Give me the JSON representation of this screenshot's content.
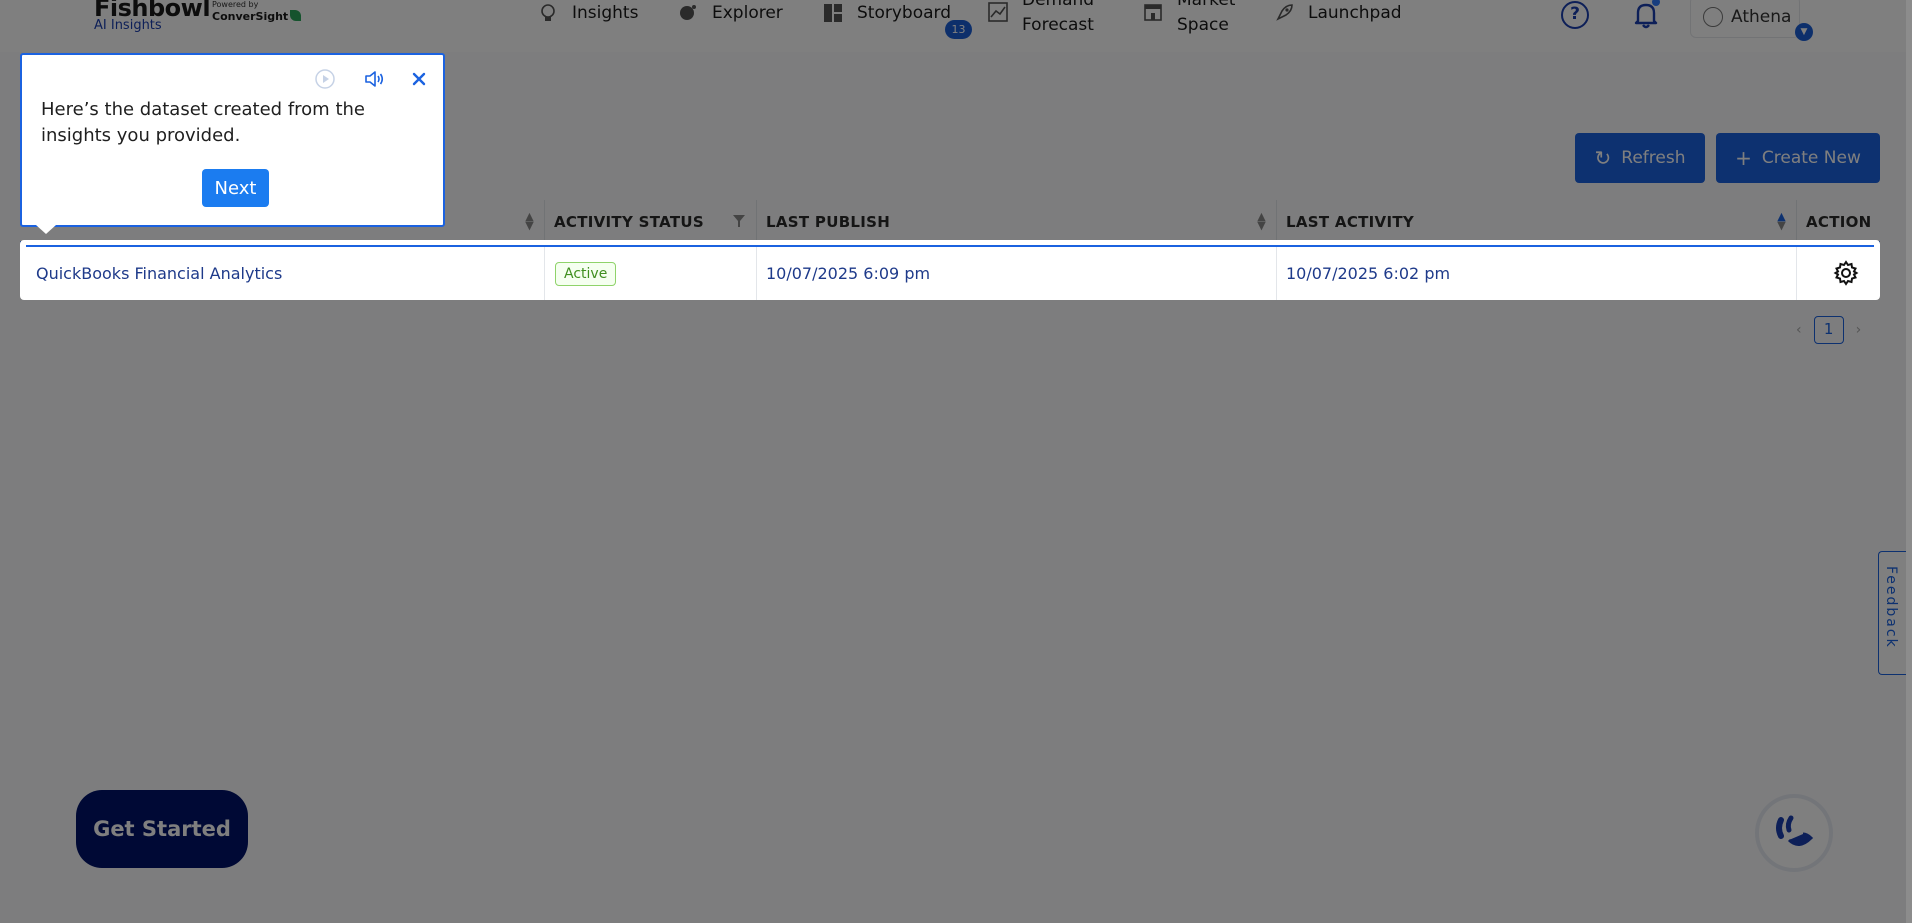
{
  "header": {
    "logo_main": "Fishbowl",
    "logo_sub": "AI Insights",
    "powered_by": "Powered by",
    "powered_brand": "ConverSight",
    "nav": [
      {
        "label": "Insights",
        "icon": "bulb-icon"
      },
      {
        "label": "Explorer",
        "icon": "explore-icon"
      },
      {
        "label": "Storyboard",
        "icon": "storyboard-icon",
        "badge": "13"
      },
      {
        "label_line1": "Demand",
        "label_line2": "Forecast",
        "icon": "chart-icon"
      },
      {
        "label_line1": "Market",
        "label_line2": "Space",
        "icon": "store-icon"
      },
      {
        "label": "Launchpad",
        "icon": "rocket-icon"
      }
    ],
    "help_glyph": "?",
    "user_name": "Athena"
  },
  "toolbar": {
    "refresh_label": "Refresh",
    "create_label": "Create New"
  },
  "table": {
    "columns": [
      "",
      "ACTIVITY STATUS",
      "LAST PUBLISH",
      "LAST ACTIVITY",
      "ACTION"
    ],
    "rows": [
      {
        "name": "QuickBooks Financial Analytics",
        "status": "Active",
        "last_publish": "10/07/2025 6:09 pm",
        "last_activity": "10/07/2025 6:02 pm"
      }
    ]
  },
  "pagination": {
    "current_page": "1"
  },
  "feedback_label": "Feedback",
  "get_started_label": "Get Started",
  "tooltip": {
    "text": "Here’s the dataset created from the insights you provided.",
    "next_label": "Next"
  },
  "colors": {
    "accent": "#1b62e0",
    "brand_dark": "#00126a",
    "status_green": "#3f8f1f"
  }
}
